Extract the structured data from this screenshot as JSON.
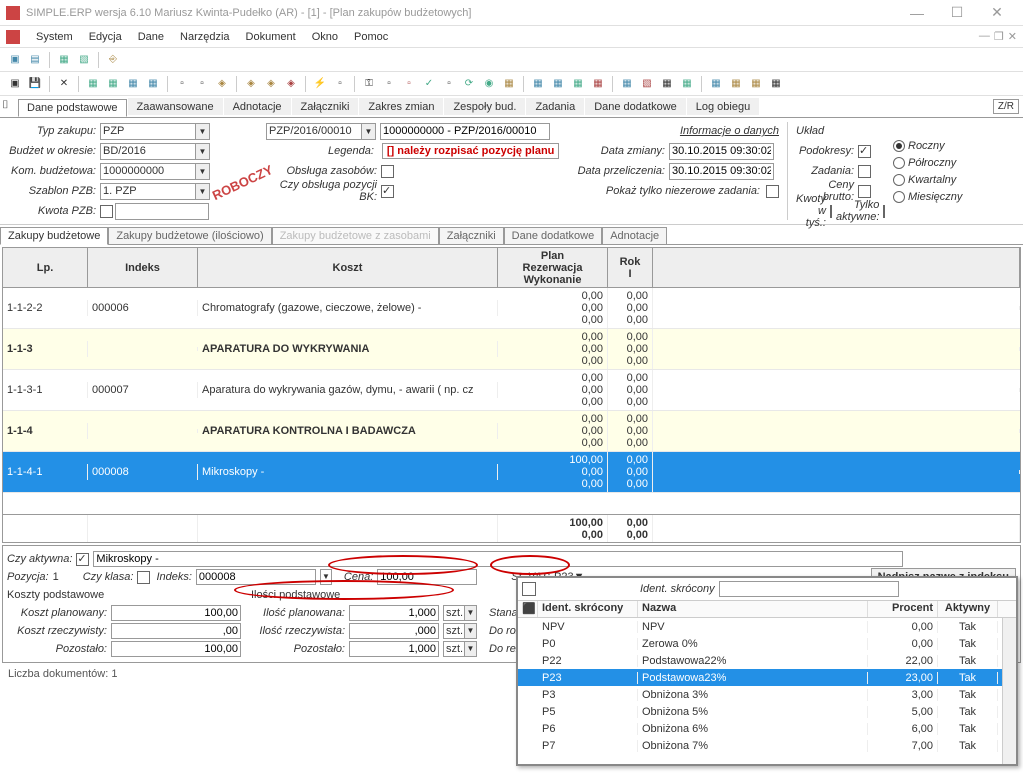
{
  "window": {
    "title": "SIMPLE.ERP wersja 6.10 Mariusz Kwinta-Pudełko (AR)  - [1] - [Plan zakupów budżetowych]"
  },
  "menu": {
    "items": [
      "System",
      "Edycja",
      "Dane",
      "Narzędzia",
      "Dokument",
      "Okno",
      "Pomoc"
    ]
  },
  "tabs_main": [
    "Dane podstawowe",
    "Zaawansowane",
    "Adnotacje",
    "Załączniki",
    "Zakres zmian",
    "Zespoły bud.",
    "Zadania",
    "Dane dodatkowe",
    "Log obiegu"
  ],
  "zr": "Z/R",
  "form": {
    "typ_zakupu_lbl": "Typ zakupu:",
    "typ_zakupu": "PZP",
    "doc_no": "PZP/2016/00010",
    "doc_full": "1000000000 - PZP/2016/00010",
    "budzet_lbl": "Budżet w okresie:",
    "budzet": "BD/2016",
    "kom_lbl": "Kom. budżetowa:",
    "kom": "1000000000",
    "szablon_lbl": "Szablon PZB:",
    "szablon": "1. PZP",
    "kwota_lbl": "Kwota PZB:",
    "legenda_lbl": "Legenda:",
    "legenda": "[] należy rozpisać pozycję planu",
    "obsluga_lbl": "Obsługa zasobów:",
    "pozycji_lbl": "Czy obsługa pozycji BK:",
    "info_lbl": "Informacje o danych",
    "data_zm_lbl": "Data zmiany:",
    "data_zm": "30.10.2015 09:30:02",
    "data_prz_lbl": "Data przeliczenia:",
    "data_prz": "30.10.2015 09:30:02",
    "niez_lbl": "Pokaż tylko niezerowe zadania:",
    "uklad_lbl": "Układ",
    "podokresy_lbl": "Podokresy:",
    "zadania_lbl": "Zadania:",
    "ceny_brutto_lbl": "Ceny brutto:",
    "kwoty_lbl": "Kwoty w tyś.:",
    "tylko_ak_lbl": "Tylko aktywne:",
    "period_options": [
      "Roczny",
      "Półroczny",
      "Kwartalny",
      "Miesięczny"
    ]
  },
  "roboczy": "ROBOCZY",
  "tabs_sub": {
    "items": [
      "Zakupy budżetowe",
      "Zakupy budżetowe (ilościowo)",
      "Zakupy budżetowe z zasobami",
      "Załączniki",
      "Dane dodatkowe",
      "Adnotacje"
    ],
    "disabled_idx": 2
  },
  "grid": {
    "headers": {
      "lp": "Lp.",
      "idx": "Indeks",
      "koszt": "Koszt",
      "plan": "Plan\nRezerwacja\nWykonanie",
      "rok": "Rok\nI"
    },
    "rows": [
      {
        "lp": "1-1-2-2",
        "idx": "000006",
        "koszt": "Chromatografy (gazowe, cieczowe, żelowe) -",
        "plan": [
          "0,00",
          "0,00",
          "0,00"
        ],
        "rok": [
          "0,00",
          "0,00",
          "0,00"
        ],
        "kind": "item"
      },
      {
        "lp": "1-1-3",
        "idx": "",
        "koszt": "APARATURA DO WYKRYWANIA",
        "plan": [
          "0,00",
          "0,00",
          "0,00"
        ],
        "rok": [
          "0,00",
          "0,00",
          "0,00"
        ],
        "kind": "group"
      },
      {
        "lp": "1-1-3-1",
        "idx": "000007",
        "koszt": "Aparatura do wykrywania gazów, dymu, - awarii ( np. cz",
        "plan": [
          "0,00",
          "0,00",
          "0,00"
        ],
        "rok": [
          "0,00",
          "0,00",
          "0,00"
        ],
        "kind": "item"
      },
      {
        "lp": "1-1-4",
        "idx": "",
        "koszt": "APARATURA KONTROLNA I BADAWCZA",
        "plan": [
          "0,00",
          "0,00",
          "0,00"
        ],
        "rok": [
          "0,00",
          "0,00",
          "0,00"
        ],
        "kind": "group"
      },
      {
        "lp": "1-1-4-1",
        "idx": "000008",
        "koszt": "Mikroskopy -",
        "plan": [
          "100,00",
          "0,00",
          "0,00"
        ],
        "rok": [
          "0,00",
          "0,00",
          "0,00"
        ],
        "kind": "selected"
      }
    ],
    "footer": {
      "plan": [
        "100,00",
        "0,00"
      ],
      "rok": [
        "0,00",
        "0,00"
      ]
    }
  },
  "lower": {
    "czy_aktywna_lbl": "Czy aktywna:",
    "name": "Mikroskopy -",
    "pozycja_lbl": "Pozycja:",
    "pozycja": "1",
    "czy_klasa_lbl": "Czy klasa:",
    "indeks_lbl": "Indeks:",
    "indeks": "000008",
    "cena_lbl": "Cena:",
    "cena": "100,00",
    "stvat_lbl": "St. VAT:",
    "stvat": "P23",
    "nadpisz": "Nadpisz nazwę z indeksu",
    "koszty_pod_hdr": "Koszty podstawowe",
    "ilosci_pod_hdr": "Ilości podstawowe",
    "koszt_plan_lbl": "Koszt planowany:",
    "koszt_plan": "100,00",
    "ilosc_plan_lbl": "Ilość planowana:",
    "ilosc_plan": "1,000",
    "uom": "szt.",
    "stana_lbl": "Stana wnio",
    "koszt_rz_lbl": "Koszt rzeczywisty:",
    "koszt_rz": ",00",
    "ilosc_rz_lbl": "Ilość rzeczywista:",
    "ilosc_rz": ",000",
    "do_rozlicz": "Do rozlicz",
    "pozost_lbl": "Pozostało:",
    "pozost_cost": "100,00",
    "pozost_qty": "1,000",
    "do_reze": "Do reze"
  },
  "status": {
    "docs_lbl": "Liczba dokumentów: ",
    "docs": "1"
  },
  "vat_popup": {
    "search_lbl": "Ident. skrócony",
    "headers": {
      "id": "Ident. skrócony",
      "name": "Nazwa",
      "pct": "Procent",
      "ak": "Aktywny"
    },
    "rows": [
      {
        "id": "NPV",
        "name": "NPV",
        "pct": "0,00",
        "ak": "Tak"
      },
      {
        "id": "P0",
        "name": "Zerowa 0%",
        "pct": "0,00",
        "ak": "Tak"
      },
      {
        "id": "P22",
        "name": "Podstawowa22%",
        "pct": "22,00",
        "ak": "Tak"
      },
      {
        "id": "P23",
        "name": "Podstawowa23%",
        "pct": "23,00",
        "ak": "Tak",
        "sel": true
      },
      {
        "id": "P3",
        "name": "Obniżona 3%",
        "pct": "3,00",
        "ak": "Tak"
      },
      {
        "id": "P5",
        "name": "Obniżona 5%",
        "pct": "5,00",
        "ak": "Tak"
      },
      {
        "id": "P6",
        "name": "Obniżona 6%",
        "pct": "6,00",
        "ak": "Tak"
      },
      {
        "id": "P7",
        "name": "Obniżona 7%",
        "pct": "7,00",
        "ak": "Tak"
      }
    ]
  }
}
